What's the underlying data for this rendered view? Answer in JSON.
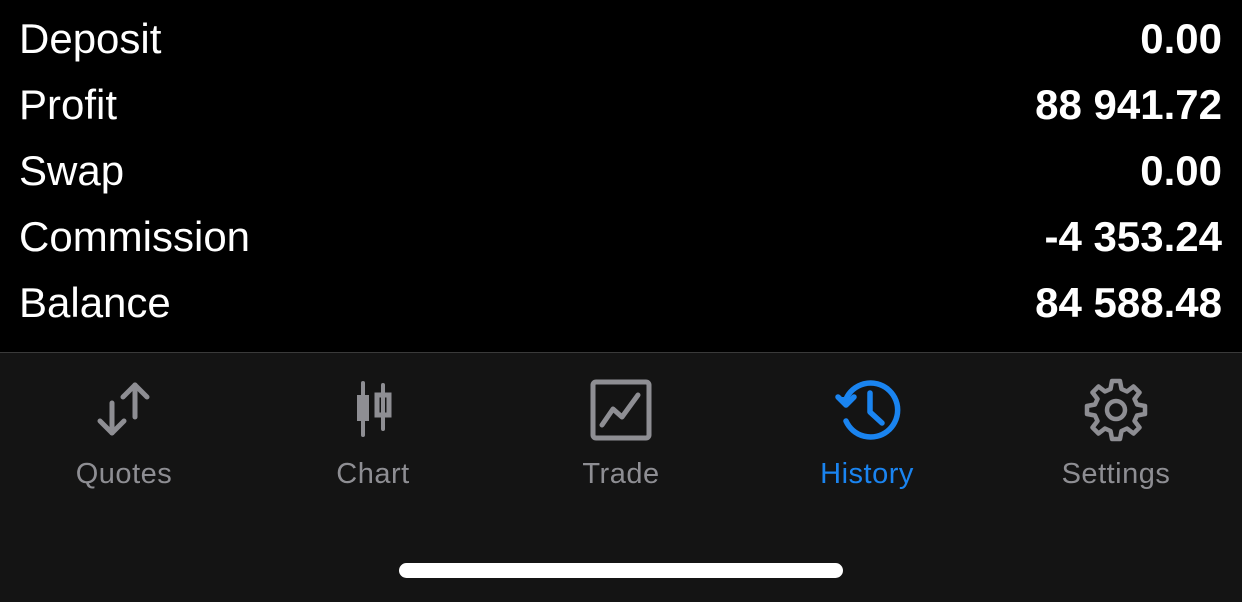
{
  "summary": {
    "rows": [
      {
        "label": "Deposit",
        "value": "0.00"
      },
      {
        "label": "Profit",
        "value": "88 941.72"
      },
      {
        "label": "Swap",
        "value": "0.00"
      },
      {
        "label": "Commission",
        "value": "-4 353.24"
      },
      {
        "label": "Balance",
        "value": "84 588.48"
      }
    ]
  },
  "tabbar": {
    "tabs": [
      {
        "label": "Quotes",
        "icon": "quotes-arrows-icon"
      },
      {
        "label": "Chart",
        "icon": "candlestick-icon"
      },
      {
        "label": "Trade",
        "icon": "trade-chart-icon"
      },
      {
        "label": "History",
        "icon": "history-clock-icon",
        "active": true
      },
      {
        "label": "Settings",
        "icon": "gear-icon"
      }
    ],
    "colors": {
      "active": "#1a84f0",
      "inactive": "#8e8e93"
    }
  }
}
